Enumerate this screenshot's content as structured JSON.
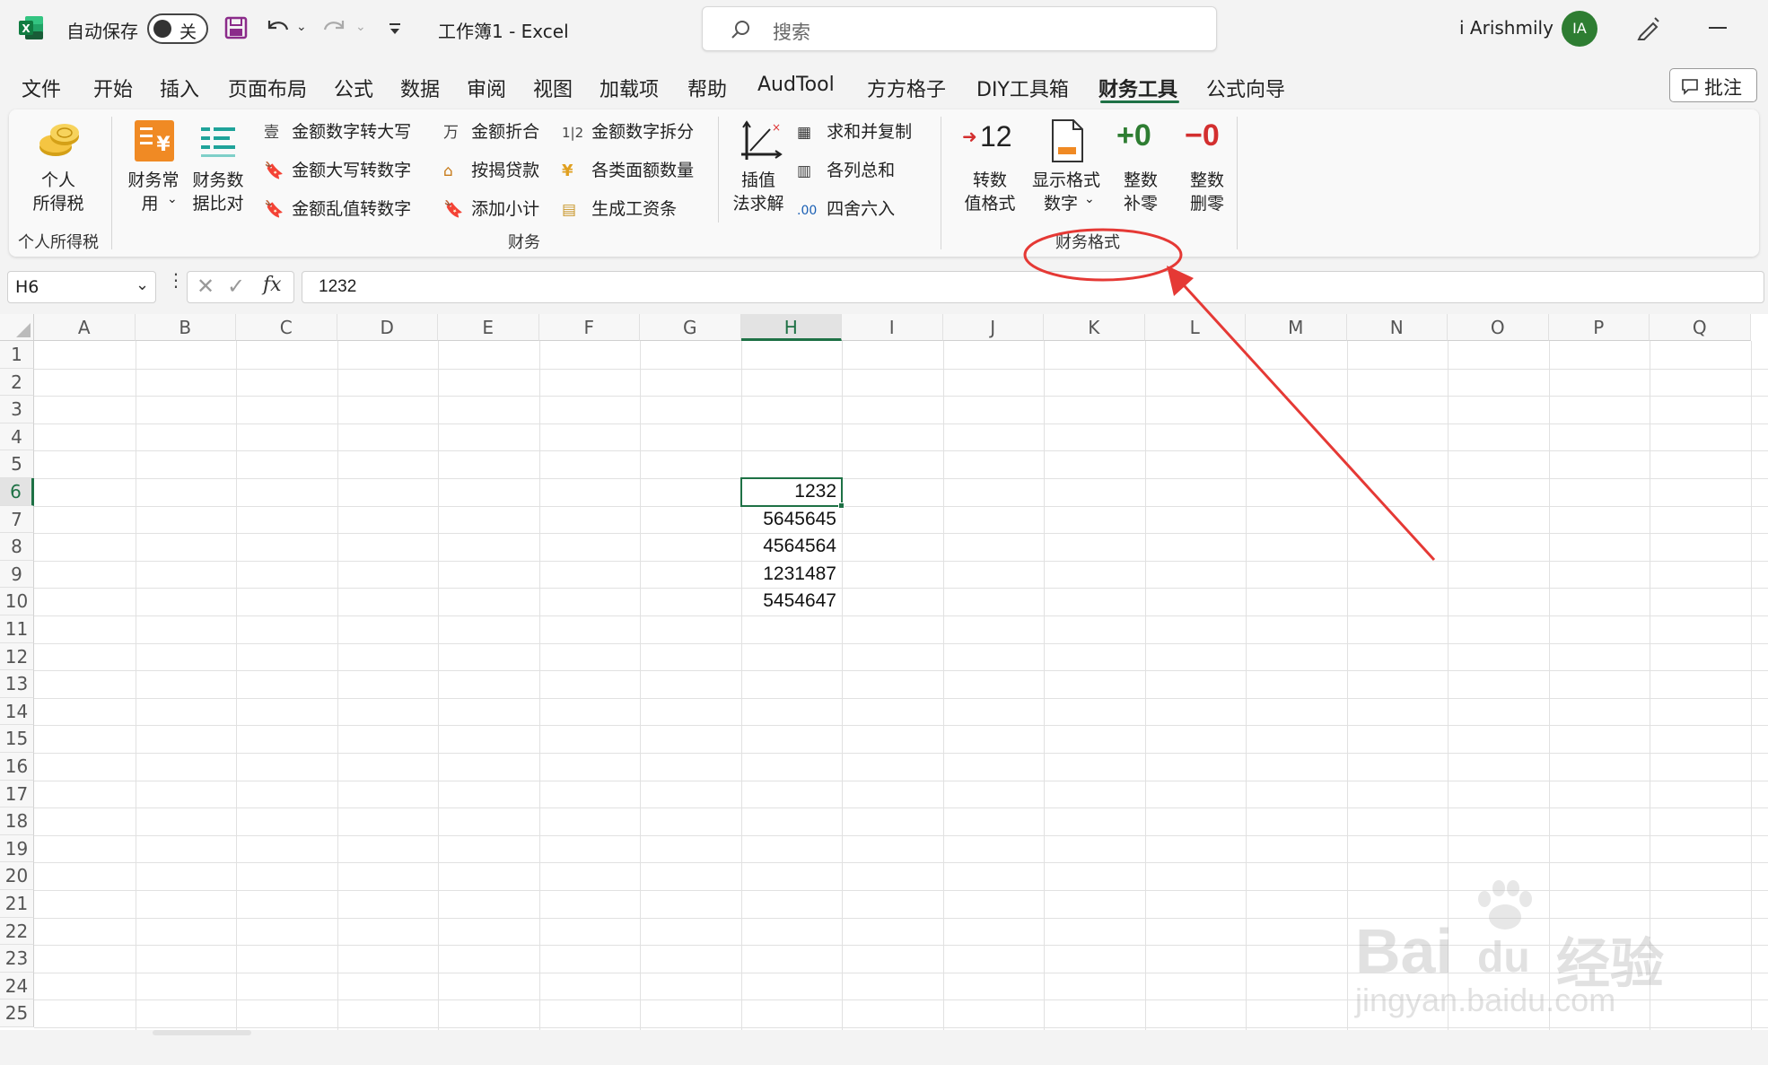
{
  "titlebar": {
    "autosave_label": "自动保存",
    "autosave_toggle": "关",
    "title": "工作簿1  -  Excel",
    "search_placeholder": "搜索",
    "user_name": "i Arishmily",
    "avatar_initials": "IA"
  },
  "menu": {
    "tabs": [
      "文件",
      "开始",
      "插入",
      "页面布局",
      "公式",
      "数据",
      "审阅",
      "视图",
      "加载项",
      "帮助",
      "AudTool",
      "方方格子",
      "DIY工具箱",
      "财务工具",
      "公式向导"
    ],
    "active_tab": "财务工具",
    "comment_button": "批注"
  },
  "ribbon": {
    "tax_group": {
      "btn_line1": "个人",
      "btn_line2": "所得税",
      "group_label": "个人所得税"
    },
    "finance_group": {
      "common_line1": "财务常",
      "common_line2": "用",
      "compare_line1": "财务数",
      "compare_line2": "据比对",
      "small_col1": [
        "金额数字转大写",
        "金额大写转数字",
        "金额乱值转数字"
      ],
      "small_col2": [
        "金额折合",
        "按揭贷款",
        "添加小计"
      ],
      "small_col3": [
        "金额数字拆分",
        "各类面额数量",
        "生成工资条"
      ],
      "interp_line1": "插值",
      "interp_line2": "法求解",
      "small_col4": [
        "求和并复制",
        "各列总和",
        "四舍六入"
      ],
      "group_label": "财务"
    },
    "format_group": {
      "convert_icon_text": "12",
      "convert_line1": "转数",
      "convert_line2": "值格式",
      "display_line1": "显示格式",
      "display_line2": "数字",
      "plus_zero_icon": "+0",
      "plus_zero_line1": "整数",
      "plus_zero_line2": "补零",
      "minus_zero_icon": "−0",
      "minus_zero_line1": "整数",
      "minus_zero_line2": "删零",
      "group_label": "财务格式"
    }
  },
  "formula_bar": {
    "name_box": "H6",
    "fx": "fx",
    "value": "1232"
  },
  "sheet": {
    "columns": [
      "A",
      "B",
      "C",
      "D",
      "E",
      "F",
      "G",
      "H",
      "I",
      "J",
      "K",
      "L",
      "M",
      "N",
      "O",
      "P",
      "Q"
    ],
    "rows": [
      "1",
      "2",
      "3",
      "4",
      "5",
      "6",
      "7",
      "8",
      "9",
      "10",
      "11",
      "12",
      "13",
      "14",
      "15",
      "16",
      "17",
      "18",
      "19",
      "20",
      "21",
      "22",
      "23",
      "24",
      "25"
    ],
    "active_cell": "H6",
    "values_col_H": [
      "1232",
      "5645645",
      "4564564",
      "1231487",
      "5454647"
    ]
  },
  "watermark": {
    "brand": "Bai",
    "brand2": "du",
    "cn": "经验",
    "url": "jingyan.baidu.com"
  },
  "colors": {
    "excel_green": "#1e7145",
    "annotation_red": "#e53935",
    "avatar_green": "#2e7d32"
  }
}
